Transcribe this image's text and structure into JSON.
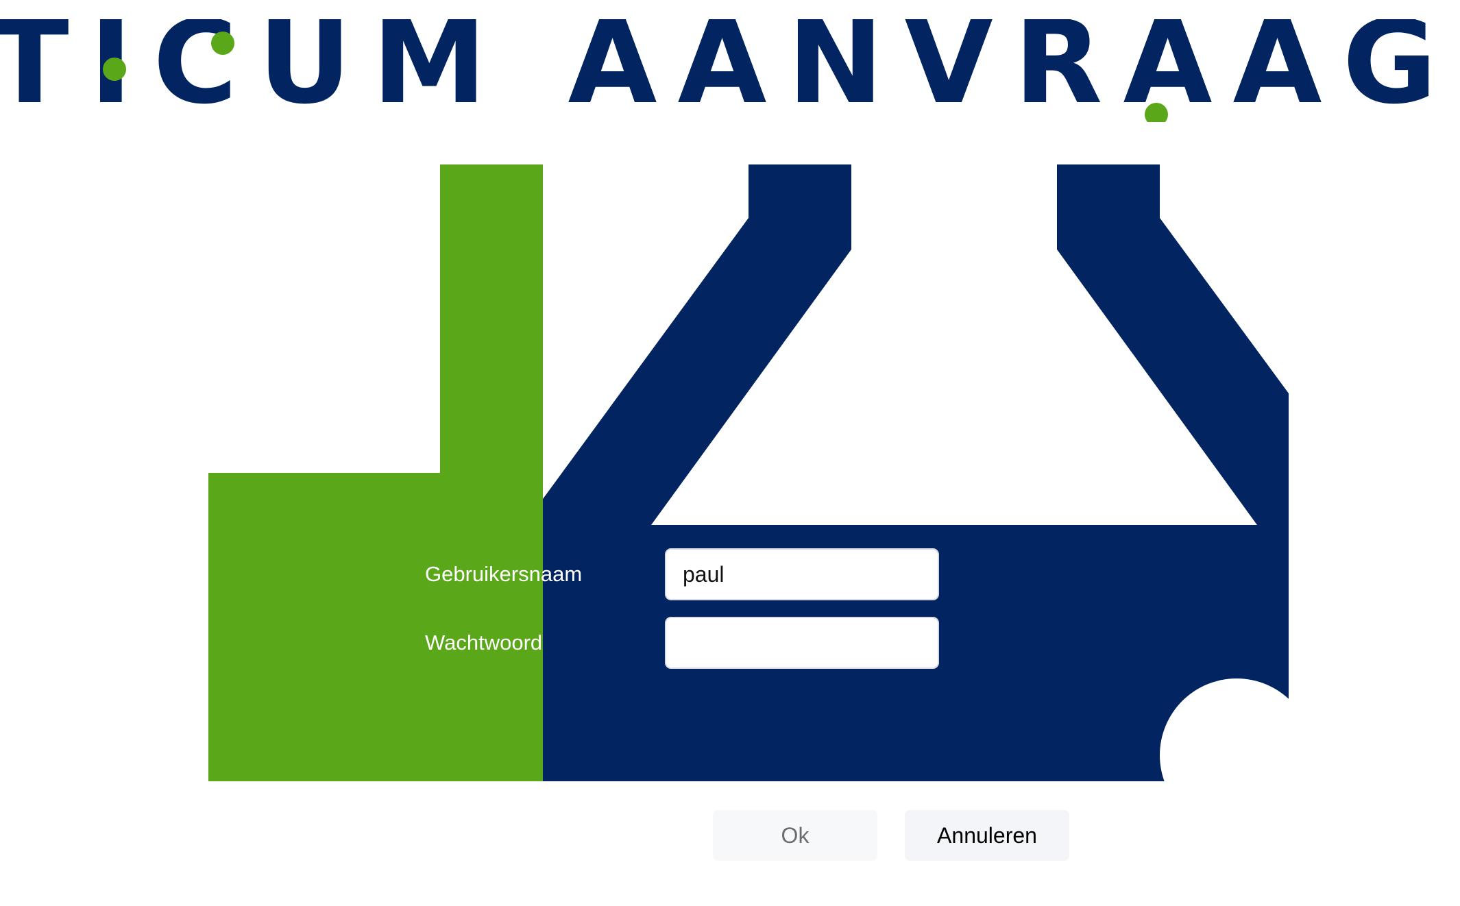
{
  "banner": {
    "text": "TICUM AANVRAAG"
  },
  "form": {
    "username": {
      "label": "Gebruikersnaam",
      "value": "paul"
    },
    "password": {
      "label": "Wachtwoord",
      "value": ""
    }
  },
  "buttons": {
    "ok_label": "Ok",
    "cancel_label": "Annuleren"
  },
  "colors": {
    "brand_navy": "#022561",
    "brand_green": "#5aa719",
    "background": "#ffffff"
  }
}
